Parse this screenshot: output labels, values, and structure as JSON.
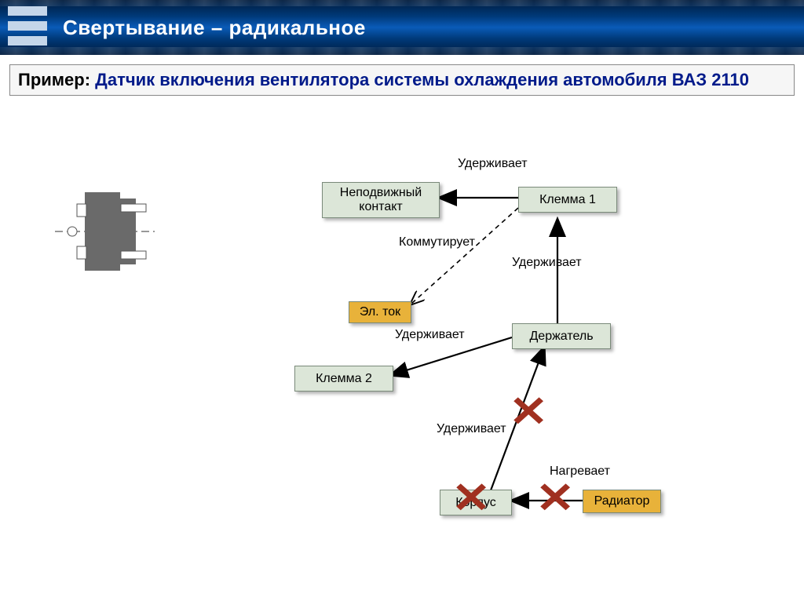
{
  "header": {
    "title": "Свертывание – радикальное"
  },
  "example": {
    "label": "Пример: ",
    "text": "Датчик включения вентилятора системы охлаждения автомобиля ВАЗ 2110"
  },
  "nodes": {
    "fixed_contact": "Неподвижный контакт",
    "terminal1": "Клемма 1",
    "terminal2": "Клемма 2",
    "el_current": "Эл. ток",
    "holder": "Держатель",
    "body": "Корпус",
    "radiator": "Радиатор"
  },
  "labels": {
    "holds1": "Удерживает",
    "commutes": "Коммутирует",
    "holds2": "Удерживает",
    "holds3": "Удерживает",
    "holds4": "Удерживает",
    "heats": "Нагревает"
  }
}
